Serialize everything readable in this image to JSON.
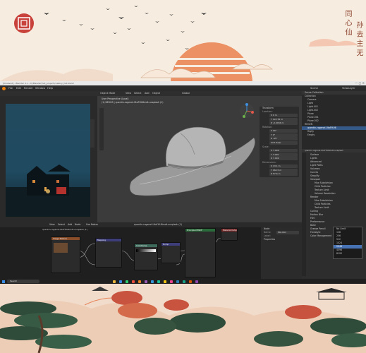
{
  "wallpaper": {
    "calligraphy_left": "同 心 仙",
    "calligraphy_right": "孙 去 主 无",
    "colors": {
      "sun": "#e07a4f",
      "cream": "#f6ecdf",
      "seal": "#c8413a",
      "tree": "#2f4b3a"
    }
  },
  "window": {
    "title": "[Unsaved] - Blender 4.x - D:\\Blender\\hat_project\\cowboy_hat.blend"
  },
  "menu": {
    "items": [
      "File",
      "Edit",
      "Render",
      "Window",
      "Help"
    ],
    "workspaces": [
      "Layout",
      "Modeling",
      "Sculpting",
      "UV Editing",
      "Texture Paint",
      "Shading",
      "Animation",
      "Rendering",
      "Compositing",
      "Geometry Nodes",
      "Scripting"
    ],
    "active_workspace": "Layout",
    "scene_label": "Scene",
    "view_layer_label": "ViewLayer"
  },
  "viewport": {
    "mode": "Object Mode",
    "menu": [
      "View",
      "Select",
      "Add",
      "Object"
    ],
    "transform": "Global",
    "info_line1": "User Perspective (Local)",
    "info_line2": "(1) NEXUS | quentin-rogenel-UtoFHU6mdt-unsplash (1)",
    "n_panel": {
      "title": "Transform",
      "location_label": "Location:",
      "location": [
        "X  0 m",
        "Y  19.735 m",
        "Z  -0.0034 m"
      ],
      "rotation_label": "Rotation:",
      "rotation": [
        "X  90°",
        "Y  0°",
        "Z  -45°"
      ],
      "mode": "XYZ Euler",
      "scale_label": "Scale:",
      "scale": [
        "X  7.000",
        "Y  7.000",
        "Z  7.000"
      ],
      "dimensions_label": "Dimensions:",
      "dimensions": [
        "X  13.1 m",
        "Y  162.5 m",
        "Z  57.6 m"
      ]
    }
  },
  "outliner": {
    "title": "Scene Collection",
    "items": [
      "Scene Collection",
      "Collection",
      "Camera",
      "Light",
      "Light.001",
      "Light.002",
      "Plane",
      "Plane.001",
      "Plane.002",
      "REGEN",
      "quentin-rogenel-UtoFHU6",
      "Rigify",
      "Empty"
    ]
  },
  "properties": {
    "header": "quentin-rogenel-UtoFHU6mdt-unsplash",
    "sections": [
      "Surface",
      "Lights",
      "Advanced",
      "Light Paths",
      "Volumes",
      "Curves",
      "Simplify",
      "Viewport",
      "Max Subdivision",
      "Child Particles",
      "Texture Limit",
      "Volume Resolution",
      "Render",
      "Max Subdivision",
      "Child Particles",
      "Texture Limit",
      "Culling",
      "Motion Blur",
      "Film",
      "Performance",
      "Bake",
      "Grease Pencil",
      "Freestyle",
      "Color Management"
    ],
    "dropdown_options": [
      "No Limit",
      "128",
      "256",
      "512",
      "1024",
      "2048",
      "4096",
      "8192"
    ],
    "dropdown_selected": "2048"
  },
  "node_editor": {
    "menu": [
      "View",
      "Select",
      "Add",
      "Node"
    ],
    "use_nodes": "Use Nodes",
    "material": "quentin-rogenel-UtoFHU6mdt-unsplash (1)",
    "breadcrumb": "quentin-rogenel-UtoFHU6mdt-unsplash (1)",
    "nodes": [
      "Principled BSDF",
      "Image Texture",
      "Mapping",
      "Texture Coordinate",
      "ColorRamp",
      "Material Output",
      "Bump"
    ],
    "side_panel": {
      "title": "Node",
      "name_label": "Name:",
      "name_value": "Mix.001",
      "label_label": "Label:",
      "properties": "Properties"
    }
  },
  "taskbar": {
    "search_placeholder": "Search",
    "icon_colors": [
      "#e9b53a",
      "#3a8ee6",
      "#2ecc71",
      "#e74c3c",
      "#e67e22",
      "#9b59b6",
      "#3498db",
      "#1abc9c",
      "#f1c40f",
      "#e84393",
      "#2980b9",
      "#16a085",
      "#d35400",
      "#8e44ad"
    ]
  }
}
